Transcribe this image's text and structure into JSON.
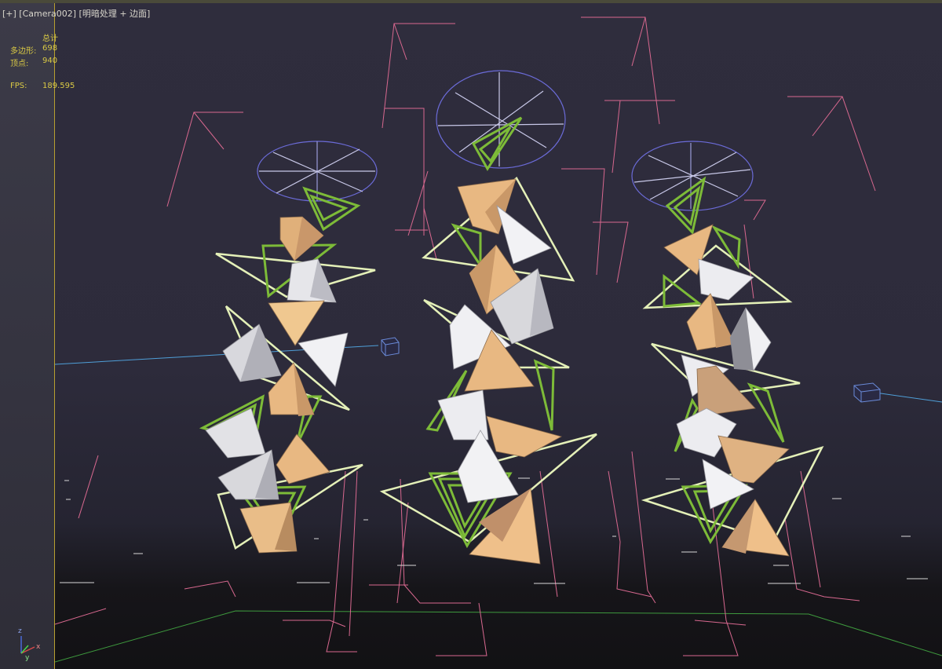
{
  "viewport": {
    "label": "[+]  [Camera002]  [明暗处理 + 边面]"
  },
  "stats": {
    "header": "总计",
    "rows": [
      {
        "label": "多边形:",
        "value": "698"
      },
      {
        "label": "顶点:",
        "value": "940"
      }
    ],
    "fps_label": "FPS:",
    "fps_value": "189.595"
  },
  "axis_gizmo": {
    "x": "x",
    "y": "y",
    "z": "z"
  },
  "colors": {
    "background": "#2e2c3c",
    "tan": "#e8b882",
    "white": "#e9e9ee",
    "green": "#7dbb38",
    "pale_green": "#e4f0b8",
    "pink": "#d8688f",
    "light_ring": "#6b6bd8"
  }
}
